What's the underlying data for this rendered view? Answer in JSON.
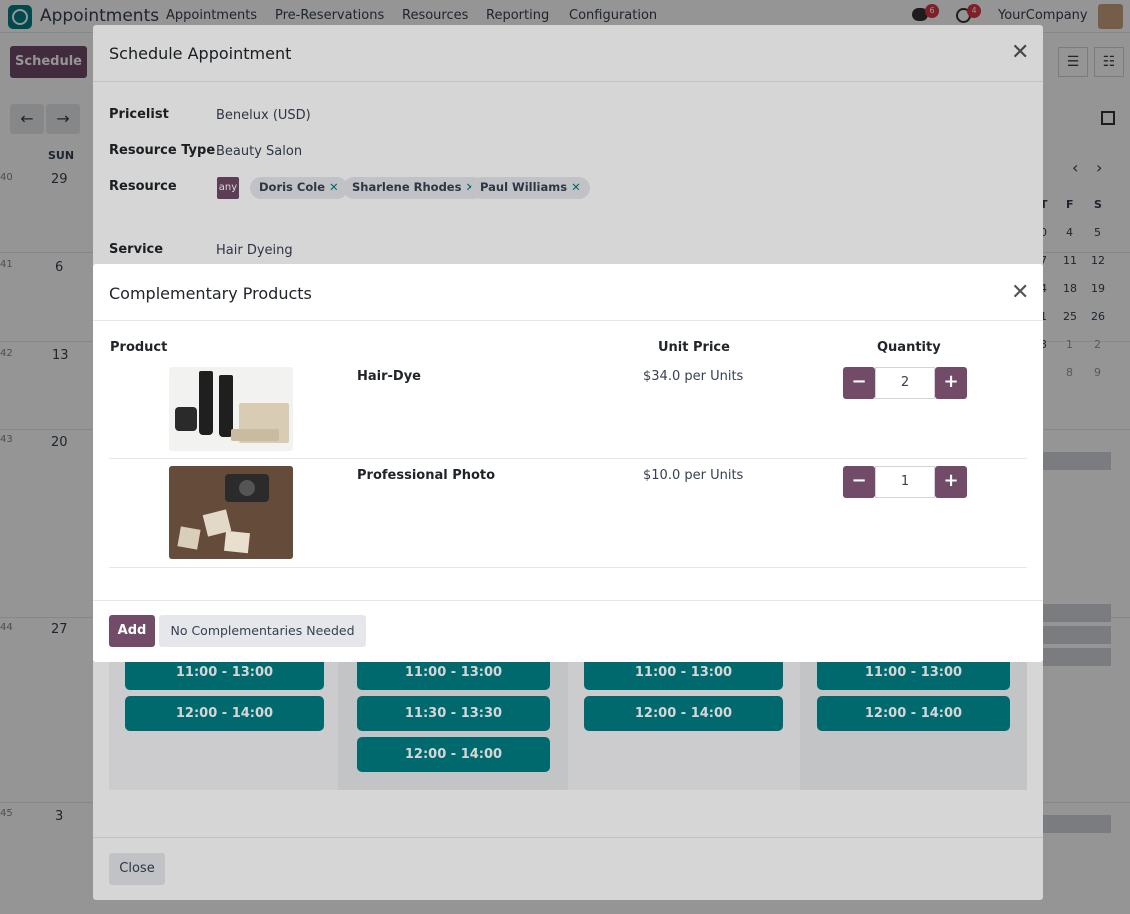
{
  "nav": {
    "app_title": "Appointments",
    "menu": [
      "Appointments",
      "Pre-Reservations",
      "Resources",
      "Reporting",
      "Configuration"
    ],
    "messages_badge": "6",
    "activities_badge": "4",
    "company": "YourCompany"
  },
  "bg": {
    "schedule_button": "Schedule",
    "day_header": "SUN",
    "weeks": [
      "40",
      "41",
      "42",
      "43",
      "44",
      "45"
    ],
    "days": [
      "29",
      "6",
      "13",
      "20",
      "27",
      "3"
    ],
    "mini_cal": {
      "headers": [
        "F",
        "S"
      ],
      "rows": [
        [
          "4",
          "5"
        ],
        [
          "11",
          "12"
        ],
        [
          "18",
          "19"
        ],
        [
          "25",
          "26"
        ],
        [
          "1",
          "2"
        ],
        [
          "8",
          "9"
        ]
      ],
      "prefix": [
        "T",
        "0",
        "7",
        "4",
        "1",
        "3"
      ]
    }
  },
  "outer": {
    "title": "Schedule Appointment",
    "pricelist_label": "Pricelist",
    "pricelist_value": "Benelux (USD)",
    "resource_type_label": "Resource Type",
    "resource_type_value": "Beauty Salon",
    "resource_label": "Resource",
    "any_badge": "any",
    "resources": [
      "Doris Cole",
      "Sharlene Rhodes",
      "Paul Williams"
    ],
    "service_label": "Service",
    "service_value": "Hair Dyeing",
    "slots": {
      "col1": [
        "11:00 - 13:00",
        "12:00 - 14:00"
      ],
      "col2": [
        "11:00 - 13:00",
        "11:30 - 13:30",
        "12:00 - 14:00"
      ],
      "col3": [
        "11:00 - 13:00",
        "12:00 - 14:00"
      ],
      "col4": [
        "11:00 - 13:00",
        "12:00 - 14:00"
      ]
    },
    "close_button": "Close"
  },
  "inner": {
    "title": "Complementary Products",
    "headers": {
      "product": "Product",
      "unit_price": "Unit Price",
      "quantity": "Quantity"
    },
    "rows": [
      {
        "name": "Hair-Dye",
        "price": "$34.0 per Units",
        "qty": "2"
      },
      {
        "name": "Professional Photo",
        "price": "$10.0 per Units",
        "qty": "1"
      }
    ],
    "add_button": "Add",
    "skip_button": "No Complementaries Needed"
  },
  "colors": {
    "brand": "#714b67",
    "teal": "#017e84",
    "badge_red": "#dc3545"
  },
  "icons": [
    "app-logo-icon",
    "chat-icon",
    "clock-icon",
    "close-icon",
    "minus-icon",
    "plus-icon",
    "arrow-left-icon",
    "arrow-right-icon",
    "list-view-icon",
    "chevron-left-icon",
    "chevron-right-icon",
    "sidebar-toggle-icon"
  ]
}
